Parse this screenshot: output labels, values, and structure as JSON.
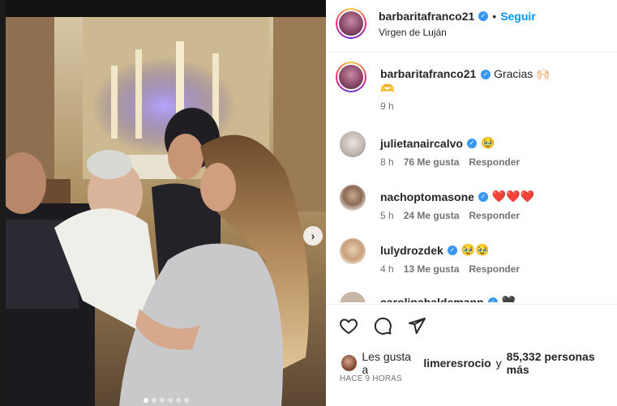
{
  "post": {
    "username": "barbaritafranco21",
    "separator": "•",
    "follow_label": "Seguir",
    "location": "Virgen de Luján"
  },
  "caption": {
    "username": "barbaritafranco21",
    "text": "Gracias 🙌🏻",
    "text_line2": "🫶",
    "time": "9 h"
  },
  "comments": [
    {
      "username": "julietanaircalvo",
      "text": "🥹",
      "time": "8 h",
      "likes": "76 Me gusta",
      "reply": "Responder"
    },
    {
      "username": "nachoptomasone",
      "text": "❤️❤️❤️",
      "time": "5 h",
      "likes": "24 Me gusta",
      "reply": "Responder"
    },
    {
      "username": "lulydrozdek",
      "text": "🥹🥹",
      "time": "4 h",
      "likes": "13 Me gusta",
      "reply": "Responder"
    },
    {
      "username": "carolinabaldemann",
      "text": "🖤"
    }
  ],
  "likes_line": {
    "prefix": "Les gusta a",
    "user": "limeresrocio",
    "middle": "y",
    "count": "85,332 personas más"
  },
  "timestamp": "HACE 9 HORAS",
  "carousel": {
    "slide_count": 6,
    "active_index": 0
  },
  "icons": [
    "heart-icon",
    "comment-icon",
    "share-icon",
    "chevron-right-icon",
    "verified-badge"
  ],
  "colors": {
    "follow": "#0095f6",
    "verified": "#3897f0",
    "muted": "#737373"
  }
}
